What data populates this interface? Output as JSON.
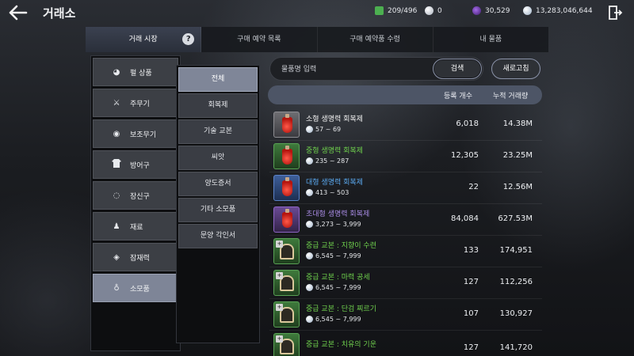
{
  "header": {
    "title": "거래소",
    "back_icon": "back-arrow-icon",
    "exit_icon": "exit-door-icon",
    "currencies": [
      {
        "name": "inventory",
        "icon": "bag-icon",
        "value": "209/496",
        "color": "#4caf50"
      },
      {
        "name": "pearl",
        "icon": "pearl-icon",
        "value": "0",
        "color": "#c9cfd8"
      },
      {
        "name": "gem",
        "icon": "purple-gem-icon",
        "value": "30,529",
        "color": "#7a3fc2"
      },
      {
        "name": "silver",
        "icon": "silver-coin-icon",
        "value": "13,283,046,644",
        "color": "#bcc8d8"
      }
    ]
  },
  "tabs": [
    {
      "label": "거래 시장",
      "active": true
    },
    {
      "label": "구매 예약 목록",
      "active": false
    },
    {
      "label": "구매 예약품 수령",
      "active": false
    },
    {
      "label": "내 물품",
      "active": false
    }
  ],
  "help_label": "?",
  "categories": [
    {
      "label": "펄 상품",
      "icon": "pearl-icon",
      "glyph": "◕",
      "active": false
    },
    {
      "label": "주무기",
      "icon": "crossed-swords-icon",
      "glyph": "⚔",
      "active": false
    },
    {
      "label": "보조무기",
      "icon": "shield-icon",
      "glyph": "◉",
      "active": false
    },
    {
      "label": "방어구",
      "icon": "armor-icon",
      "glyph": "👕",
      "active": false
    },
    {
      "label": "장신구",
      "icon": "ring-icon",
      "glyph": "◌",
      "active": false
    },
    {
      "label": "재료",
      "icon": "flask-icon",
      "glyph": "♟",
      "active": false
    },
    {
      "label": "잠재력",
      "icon": "diamond-icon",
      "glyph": "◈",
      "active": false
    },
    {
      "label": "소모품",
      "icon": "potion-icon",
      "glyph": "♁",
      "active": true
    }
  ],
  "subcategories": [
    {
      "label": "전체",
      "active": true
    },
    {
      "label": "회복제",
      "active": false
    },
    {
      "label": "기술 교본",
      "active": false
    },
    {
      "label": "씨앗",
      "active": false
    },
    {
      "label": "양도증서",
      "active": false
    },
    {
      "label": "기타 소모품",
      "active": false
    },
    {
      "label": "문양 각인서",
      "active": false
    }
  ],
  "search": {
    "placeholder": "물품명 입력",
    "button_label": "검색",
    "refresh_label": "새로고침"
  },
  "table": {
    "col_count": "등록 개수",
    "col_volume": "누적 거래량",
    "rows": [
      {
        "name": "소형 생명력 회복제",
        "price": "57 ~ 69",
        "count": "6,018",
        "volume": "14.38M",
        "grade": "white",
        "icon": "potion-icon",
        "name_color": "#f2f2f2"
      },
      {
        "name": "중형 생명력 회복제",
        "price": "235 ~ 287",
        "count": "12,305",
        "volume": "23.25M",
        "grade": "green",
        "icon": "potion-icon",
        "name_color": "#6fd14d"
      },
      {
        "name": "대형 생명력 회복제",
        "price": "413 ~ 503",
        "count": "22",
        "volume": "12.56M",
        "grade": "blue",
        "icon": "potion-icon",
        "name_color": "#5aa9f0"
      },
      {
        "name": "초대형 생명력 회복제",
        "price": "3,273 ~ 3,999",
        "count": "84,084",
        "volume": "627.53M",
        "grade": "purple",
        "icon": "potion-icon",
        "name_color": "#a98ce6"
      },
      {
        "name": "중급 교본 : 지향이 수련",
        "price": "6,545 ~ 7,999",
        "count": "133",
        "volume": "174,951",
        "grade": "green",
        "icon": "skill-book-icon",
        "name_color": "#6fd14d"
      },
      {
        "name": "중급 교본 : 마력 공세",
        "price": "6,545 ~ 7,999",
        "count": "127",
        "volume": "112,256",
        "grade": "green",
        "icon": "skill-book-icon",
        "name_color": "#6fd14d"
      },
      {
        "name": "중급 교본 : 단검 찌르기",
        "price": "6,545 ~ 7,999",
        "count": "107",
        "volume": "130,927",
        "grade": "green",
        "icon": "skill-book-icon",
        "name_color": "#6fd14d"
      },
      {
        "name": "중급 교본 : 치유의 기운",
        "price": "",
        "count": "127",
        "volume": "141,720",
        "grade": "green",
        "icon": "skill-book-icon",
        "name_color": "#6fd14d"
      }
    ]
  }
}
